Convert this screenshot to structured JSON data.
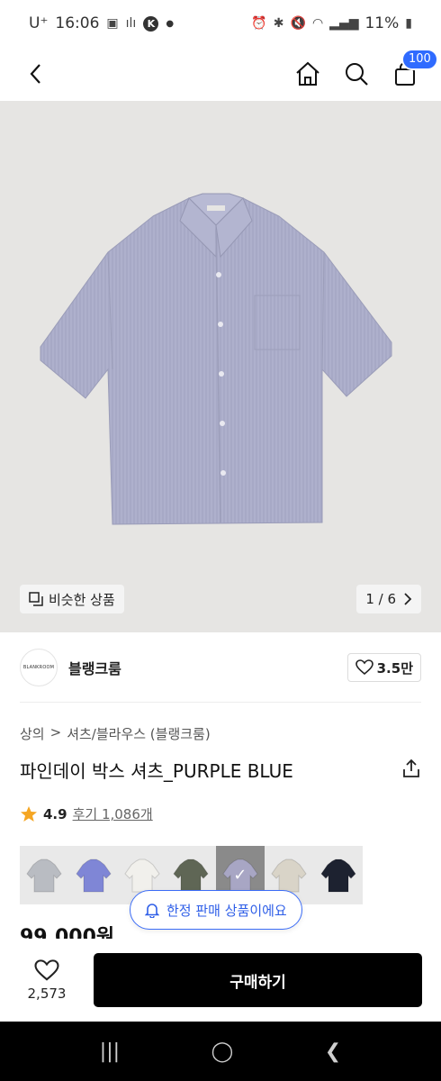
{
  "status_bar": {
    "carrier": "U⁺",
    "time": "16:06",
    "battery": "11%"
  },
  "nav": {
    "cart_count": "100"
  },
  "hero": {
    "similar_label": "비슷한 상품",
    "pager": "1 / 6"
  },
  "brand": {
    "logo_text": "BLANKROOM",
    "name": "블랭크룸",
    "likes": "3.5만"
  },
  "breadcrumb": {
    "category": "상의",
    "separator": ">",
    "subcategory": "셔츠/블라우스 (블랭크룸)"
  },
  "product": {
    "title": "파인데이 박스 셔츠_PURPLE BLUE",
    "rating": "4.9",
    "reviews": "후기 1,086개",
    "price": "99,000원",
    "limited_label": "한정 판매 상품이에요"
  },
  "swatches": [
    {
      "name": "gray",
      "color": "#b9bcc2",
      "selected": false
    },
    {
      "name": "purple-blue",
      "color": "#7f86d6",
      "selected": false
    },
    {
      "name": "white",
      "color": "#f1f0ec",
      "selected": false
    },
    {
      "name": "khaki",
      "color": "#5f6655",
      "selected": false
    },
    {
      "name": "lavender",
      "color": "#a8a6c4",
      "selected": true
    },
    {
      "name": "beige",
      "color": "#d9d4c8",
      "selected": false
    },
    {
      "name": "navy",
      "color": "#1d2230",
      "selected": false
    }
  ],
  "buy_bar": {
    "wish_count": "2,573",
    "buy_label": "구매하기"
  },
  "colors": {
    "accent_blue": "#2f6bff",
    "buy_button": "#000000",
    "star": "#f5a623",
    "shirt": "#aeb0cc"
  }
}
